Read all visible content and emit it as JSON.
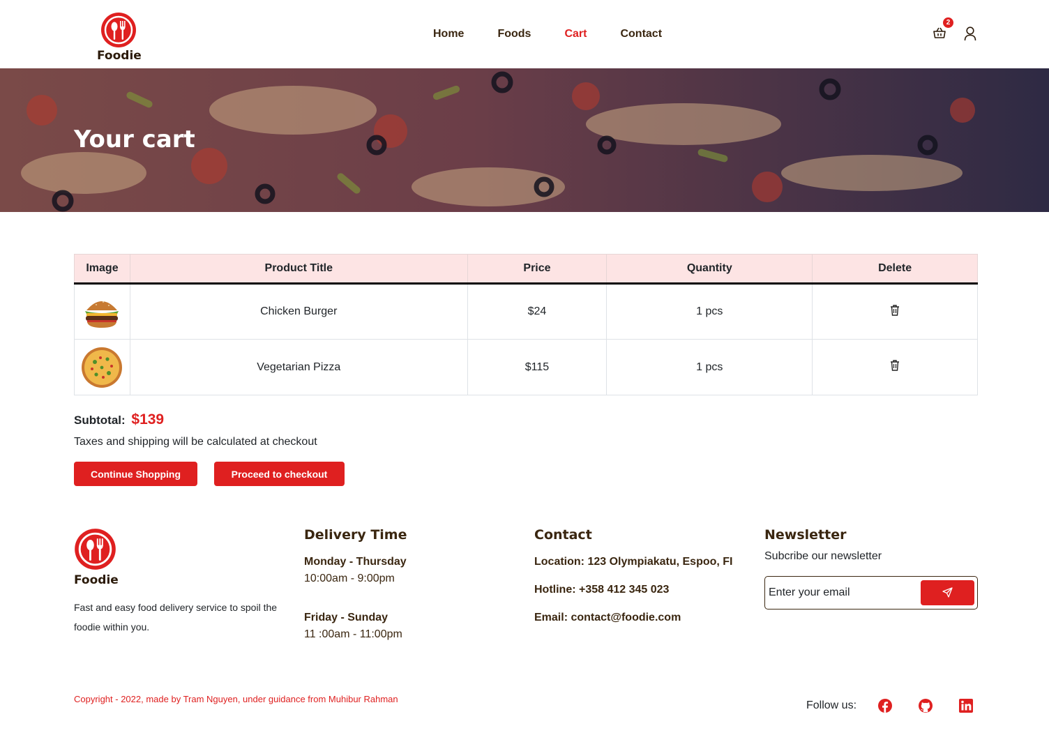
{
  "brand": {
    "name": "Foodie",
    "accent_color": "#df2020",
    "text_brown": "#3a2610"
  },
  "nav": {
    "items": [
      {
        "label": "Home",
        "active": false
      },
      {
        "label": "Foods",
        "active": false
      },
      {
        "label": "Cart",
        "active": true
      },
      {
        "label": "Contact",
        "active": false
      }
    ],
    "cart_count": "2",
    "cart_icon": "shopping-basket-icon",
    "user_icon": "user-icon"
  },
  "hero": {
    "title": "Your cart"
  },
  "table": {
    "headers": [
      "Image",
      "Product Title",
      "Price",
      "Quantity",
      "Delete"
    ],
    "rows": [
      {
        "image": "chicken-burger-image",
        "title": "Chicken Burger",
        "price": "$24",
        "quantity": "1 pcs",
        "delete_icon": "trash-icon"
      },
      {
        "image": "vegetarian-pizza-image",
        "title": "Vegetarian Pizza",
        "price": "$115",
        "quantity": "1 pcs",
        "delete_icon": "trash-icon"
      }
    ]
  },
  "summary": {
    "subtotal_label": "Subtotal:",
    "subtotal_value": "$139",
    "note": "Taxes and shipping will be calculated at checkout",
    "continue_label": "Continue Shopping",
    "checkout_label": "Proceed to checkout"
  },
  "footer": {
    "brand_name": "Foodie",
    "description": "Fast and easy food delivery service to spoil the foodie within you.",
    "delivery": {
      "title": "Delivery Time",
      "slots": [
        {
          "days": "Monday - Thursday",
          "hours": "10:00am - 9:00pm"
        },
        {
          "days": "Friday - Sunday",
          "hours": "11 :00am - 11:00pm"
        }
      ]
    },
    "contact": {
      "title": "Contact",
      "location": "Location: 123 Olympiakatu, Espoo, FI",
      "hotline": "Hotline: +358 412 345 023",
      "email": "Email: contact@foodie.com"
    },
    "newsletter": {
      "title": "Newsletter",
      "subtitle": "Subcribe our newsletter",
      "placeholder": "Enter your email",
      "send_icon": "send-icon"
    },
    "copyright": "Copyright - 2022, made by Tram Nguyen, under guidance from Muhibur Rahman",
    "follow_label": "Follow us:",
    "socials": [
      "facebook-icon",
      "github-icon",
      "linkedin-icon"
    ]
  }
}
